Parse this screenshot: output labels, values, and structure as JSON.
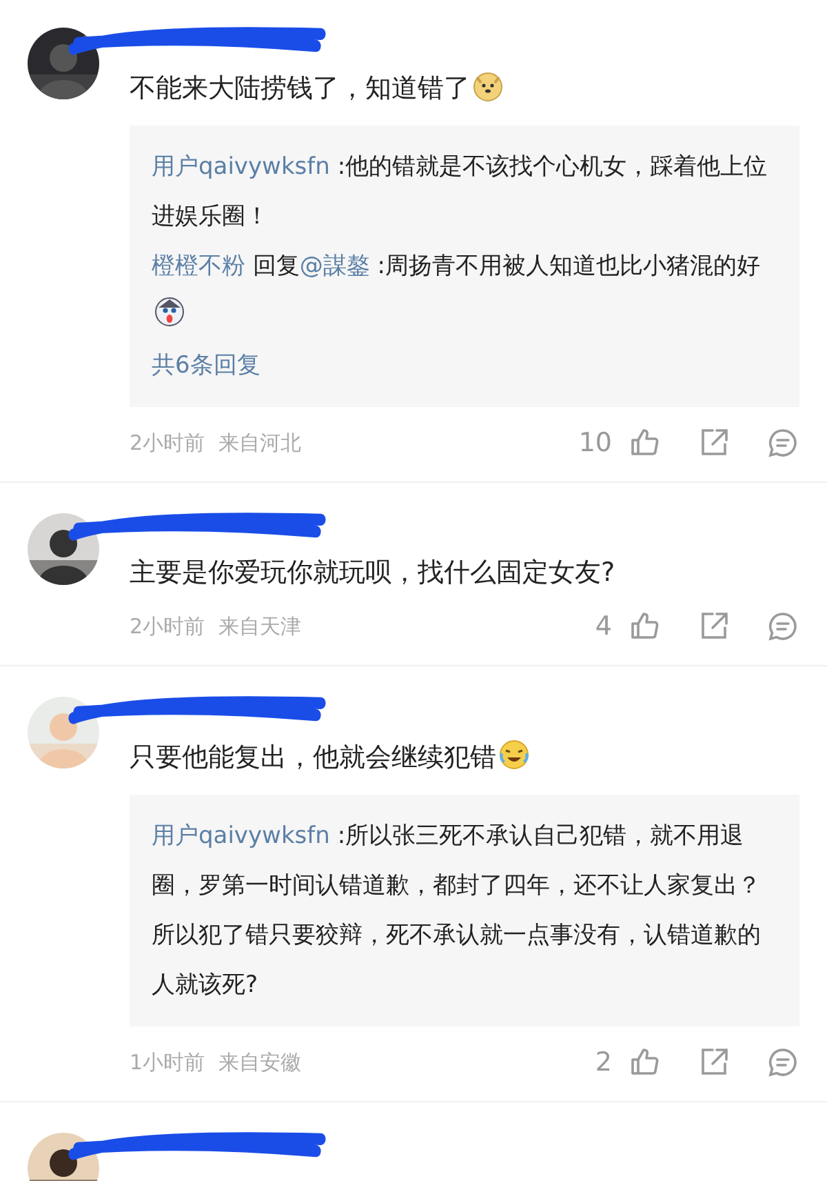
{
  "comments": [
    {
      "avatar": {
        "kind": "picture"
      },
      "text": "不能来大陆捞钱了，知道错了",
      "emoji": {
        "kind": "doge"
      },
      "replies": [
        {
          "user": "用户qaivywksfn",
          "text": ":他的错就是不该找个心机女，踩着他上位进娱乐圈！"
        },
        {
          "user": "橙橙不粉",
          "reply_word": "回复",
          "mention": "@謀鏊",
          "text": ":周扬青不用被人知道也比小猪混的好",
          "emoji": {
            "kind": "husky"
          }
        }
      ],
      "more_replies": "共6条回复",
      "time": "2小时前",
      "location": "来自河北",
      "likes": "10"
    },
    {
      "avatar": {
        "kind": "picture"
      },
      "text": "主要是你爱玩你就玩呗，找什么固定女友?",
      "time": "2小时前",
      "location": "来自天津",
      "likes": "4"
    },
    {
      "avatar": {
        "kind": "picture"
      },
      "text": "只要他能复出，他就会继续犯错",
      "emoji": {
        "kind": "laugh"
      },
      "replies": [
        {
          "user": "用户qaivywksfn",
          "text": ":所以张三死不承认自己犯错，就不用退圈，罗第一时间认错道歉，都封了四年，还不让人家复出？所以犯了错只要狡辩，死不承认就一点事没有，认错道歉的人就该死?"
        }
      ],
      "time": "1小时前",
      "location": "来自安徽",
      "likes": "2"
    },
    {
      "avatar": {
        "kind": "picture"
      }
    }
  ]
}
